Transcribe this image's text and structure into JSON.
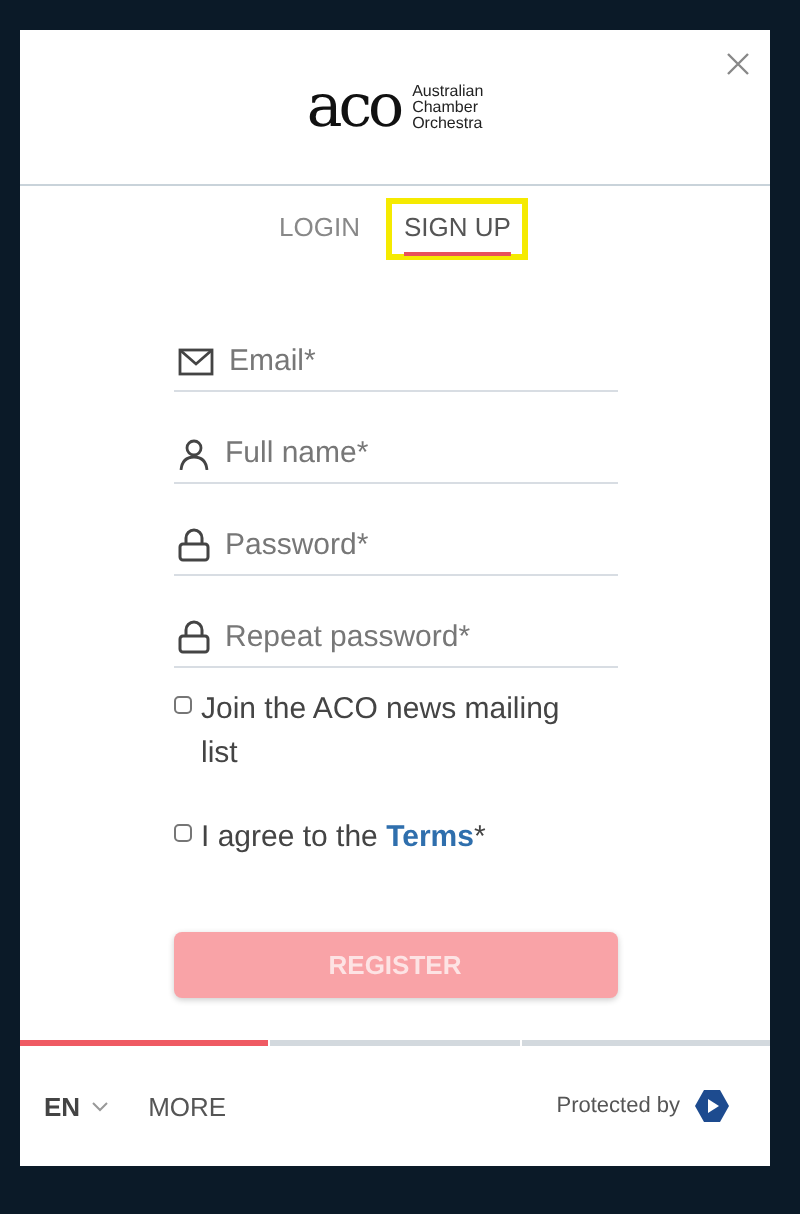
{
  "logo": {
    "mark": "aco",
    "lines": [
      "Australian",
      "Chamber",
      "Orchestra"
    ]
  },
  "tabs": [
    {
      "label": "LOGIN",
      "selected": false,
      "highlighted": false
    },
    {
      "label": "SIGN UP",
      "selected": true,
      "highlighted": true
    }
  ],
  "fields": [
    {
      "kind": "email",
      "placeholder": "Email*"
    },
    {
      "kind": "person",
      "placeholder": "Full name*"
    },
    {
      "kind": "lock",
      "placeholder": "Password*"
    },
    {
      "kind": "lock",
      "placeholder": "Repeat password*"
    }
  ],
  "checkboxes": [
    {
      "label": "Join the ACO news mailing list",
      "checked": false
    },
    {
      "label": "I agree to the **Terms***",
      "checked": false
    }
  ],
  "register_button": {
    "label": "REGISTER",
    "disabled": true
  },
  "steps": [
    {
      "done": true
    },
    {
      "done": false
    },
    {
      "done": false
    }
  ],
  "footer": {
    "language": "EN",
    "more": "MORE",
    "protected_by": "Protected by"
  }
}
